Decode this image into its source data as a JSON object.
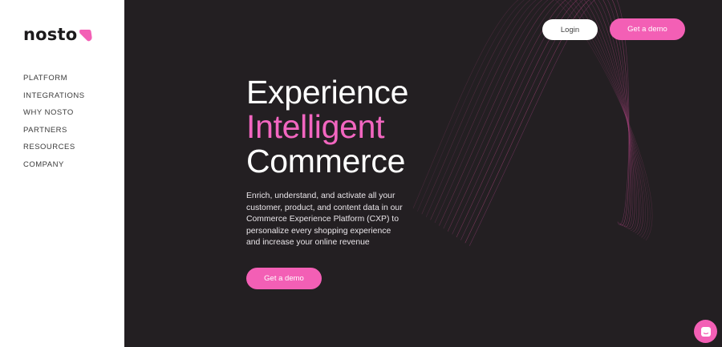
{
  "brand": {
    "name": "nosto",
    "accent": "#f35fb5"
  },
  "nav": {
    "items": [
      {
        "label": "PLATFORM"
      },
      {
        "label": "INTEGRATIONS"
      },
      {
        "label": "WHY NOSTO"
      },
      {
        "label": "PARTNERS"
      },
      {
        "label": "RESOURCES"
      },
      {
        "label": "COMPANY"
      }
    ]
  },
  "header": {
    "login_label": "Login",
    "demo_label": "Get a demo"
  },
  "hero": {
    "line1": "Experience",
    "line2": "Intelligent",
    "line3": "Commerce",
    "subtitle": "Enrich, understand, and activate all your customer, product, and content data in our Commerce Experience Platform (CXP) to personalize every shopping experience and increase your online revenue",
    "cta_label": "Get a demo"
  },
  "colors": {
    "background": "#231f22",
    "sidebar": "#ffffff",
    "highlight": "#f266c0"
  },
  "chat": {
    "icon": "chat-icon"
  }
}
